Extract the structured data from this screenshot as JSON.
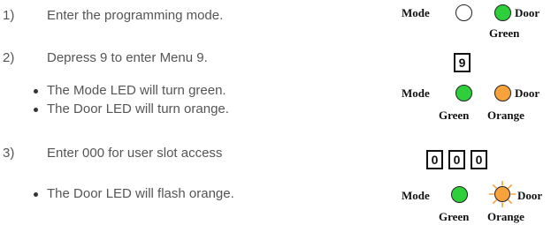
{
  "steps": [
    {
      "num": "1)",
      "text": "Enter the programming mode."
    },
    {
      "num": "2)",
      "text": "Depress 9 to enter Menu 9."
    },
    {
      "num": "3)",
      "text": "Enter 000 for user slot access"
    }
  ],
  "bullets": [
    "The Mode LED will turn green.",
    "The Door LED will turn orange.",
    "The Door LED will flash orange."
  ],
  "diagram": {
    "mode_label": "Mode",
    "door_label": "Door",
    "green_label": "Green",
    "orange_label": "Orange",
    "keys": {
      "k9": "9",
      "k0a": "0",
      "k0b": "0",
      "k0c": "0"
    }
  },
  "colors": {
    "green": "#2fce3b",
    "orange": "#f7a23c",
    "off": "#ffffff"
  }
}
